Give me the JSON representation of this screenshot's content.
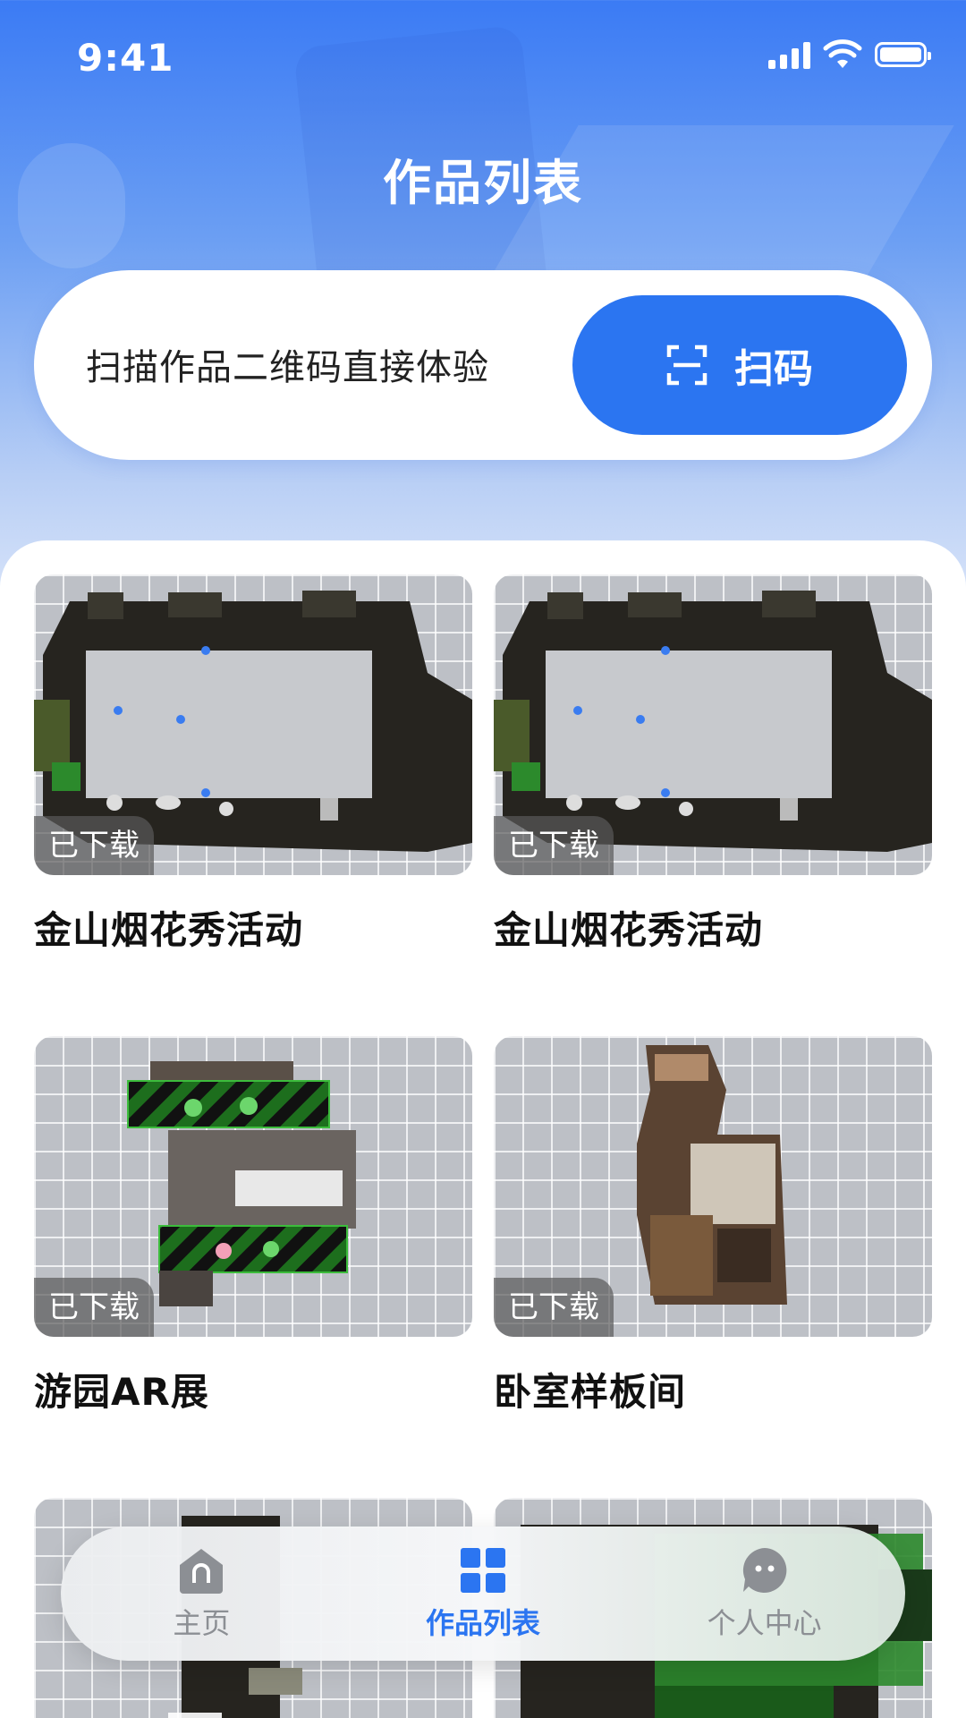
{
  "status_bar": {
    "time": "9:41"
  },
  "header": {
    "title": "作品列表"
  },
  "scan": {
    "prompt": "扫描作品二维码直接体验",
    "button_label": "扫码"
  },
  "works": [
    {
      "title": "金山烟花秀活动",
      "status": "已下载",
      "thumb": "floorplan-ring"
    },
    {
      "title": "金山烟花秀活动",
      "status": "已下载",
      "thumb": "floorplan-ring"
    },
    {
      "title": "游园AR展",
      "status": "已下载",
      "thumb": "floorplan-garden"
    },
    {
      "title": "卧室样板间",
      "status": "已下载",
      "thumb": "floorplan-bedroom"
    },
    {
      "title": "",
      "status": "",
      "thumb": "floorplan-partial-a"
    },
    {
      "title": "",
      "status": "",
      "thumb": "floorplan-partial-b"
    }
  ],
  "tabbar": {
    "tabs": [
      {
        "label": "主页",
        "icon": "home-icon",
        "active": false
      },
      {
        "label": "作品列表",
        "icon": "grid-icon",
        "active": true
      },
      {
        "label": "个人中心",
        "icon": "profile-icon",
        "active": false
      }
    ]
  },
  "colors": {
    "accent": "#2b75f1",
    "header_gradient_top": "#3b7bf4",
    "inactive_tab": "#8c8f94"
  }
}
